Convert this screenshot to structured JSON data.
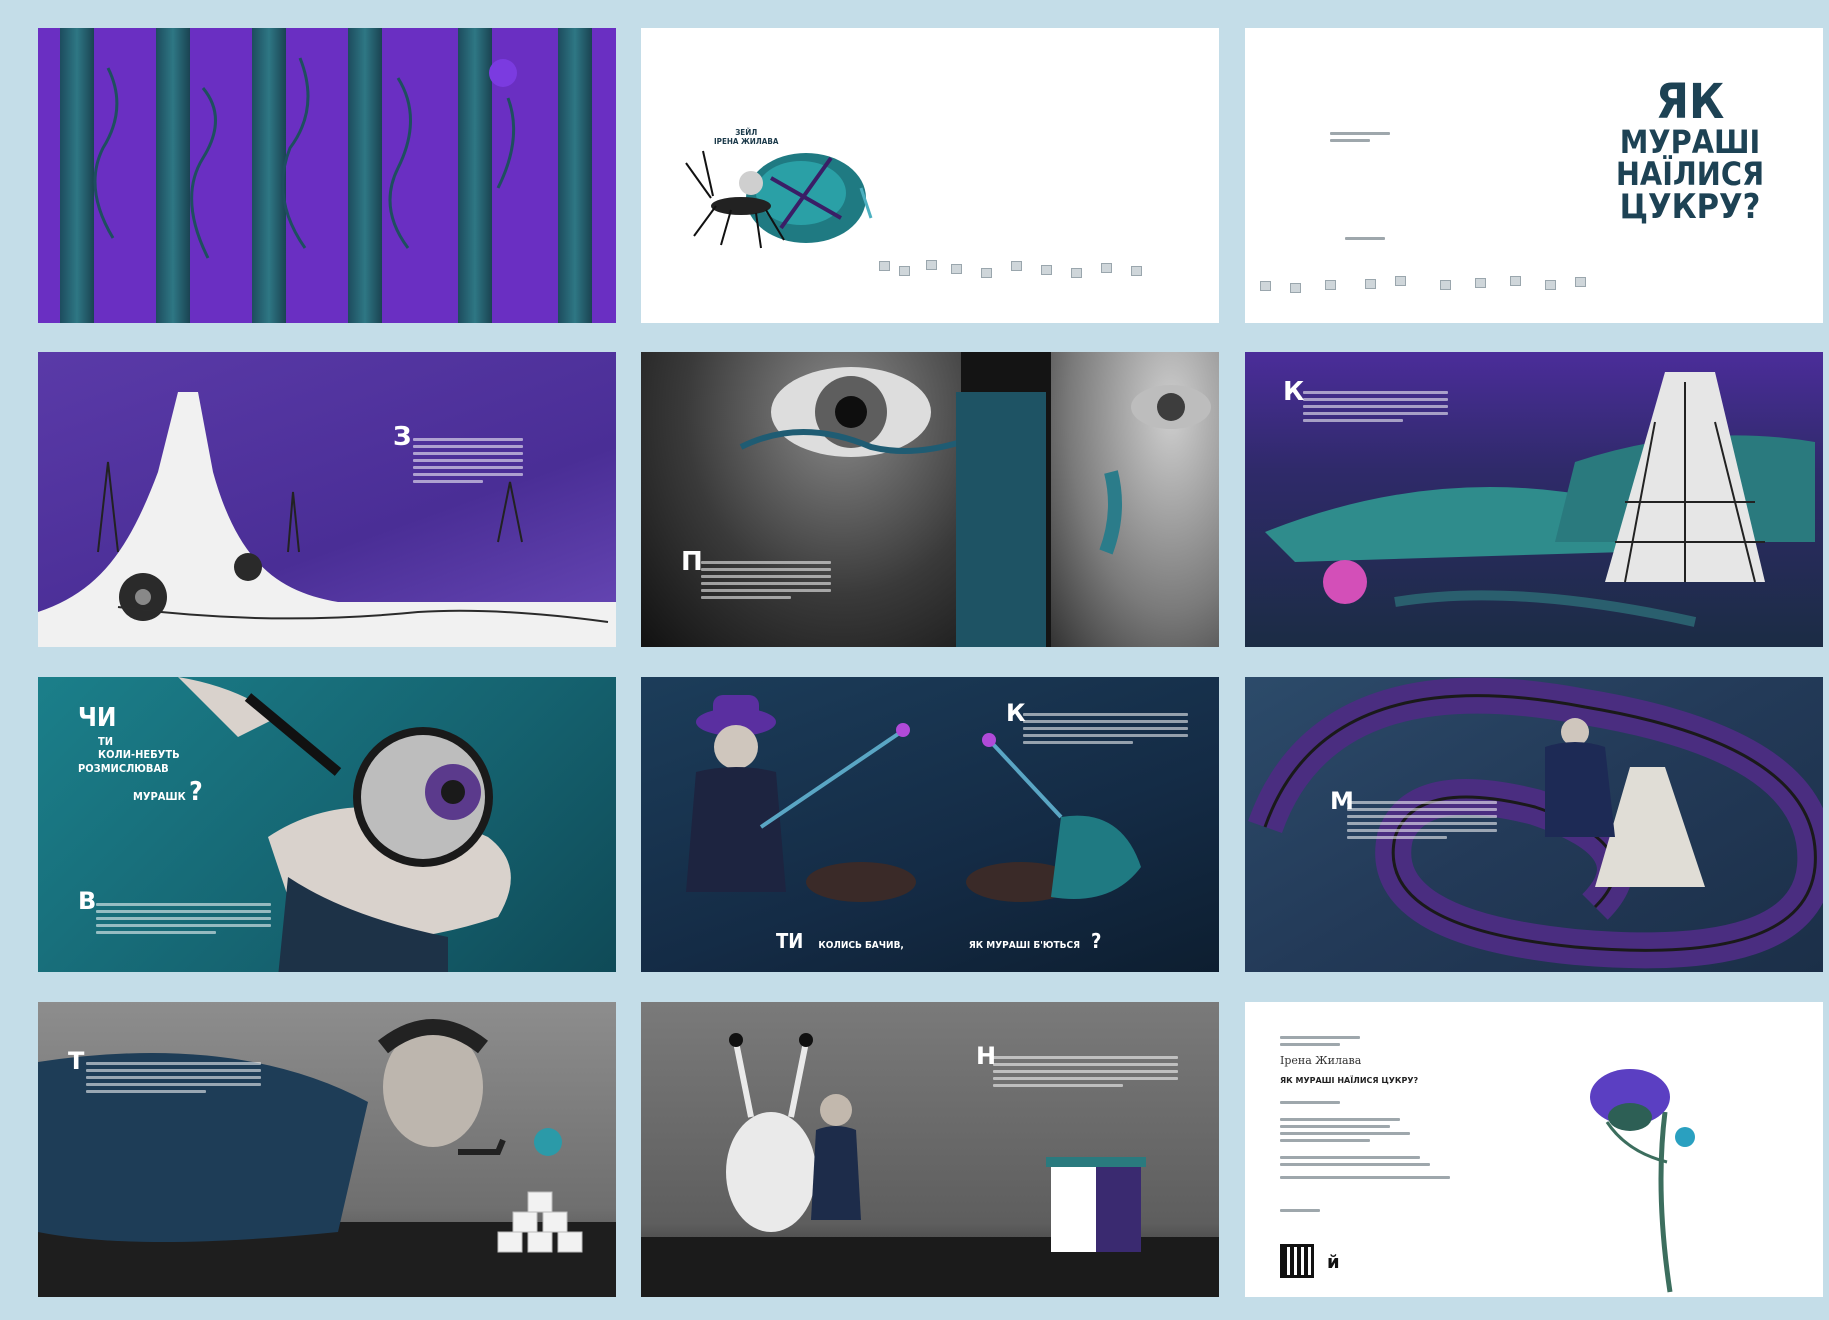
{
  "spreads": [
    {
      "id": "endpaper-pattern",
      "colors": {
        "bg": "#6b2fc4",
        "stripe": "#26606f",
        "thistle": "#7a3cd8"
      }
    },
    {
      "id": "half-title",
      "author_label": "ІРЕНА ЖИЛАВА",
      "author_prefix": "ЗЕЙЛ"
    },
    {
      "id": "title-page",
      "title_lines": [
        "ЯК",
        "МУРАШІ",
        "НАЇЛИСЯ",
        "ЦУКРУ?"
      ]
    },
    {
      "id": "salt-mountain",
      "dropcap": "З"
    },
    {
      "id": "eye-closeup",
      "dropcap": "П"
    },
    {
      "id": "shoe-mountain",
      "dropcap": "К"
    },
    {
      "id": "magnifier",
      "heading": [
        "ЧИ",
        "ТИ",
        "КОЛИ-НЕБУТЬ",
        "РОЗМИСЛЮВАВ",
        "МУРАШК",
        "?"
      ],
      "dropcap": "В"
    },
    {
      "id": "duel",
      "dropcap": "К",
      "caption_left": "ТИ",
      "caption_mid": "КОЛИСЬ БАЧИВ,",
      "caption_right": "ЯК МУРАШІ Б'ЮТЬСЯ",
      "caption_q": "?"
    },
    {
      "id": "track-loop",
      "dropcap": "М"
    },
    {
      "id": "pipe-man",
      "dropcap": "Т"
    },
    {
      "id": "door-room",
      "dropcap": "Н"
    },
    {
      "id": "imprint",
      "author": "Ірена Жилава",
      "book_title": "ЯК МУРАШІ НАЇЛИСЯ ЦУКРУ?"
    }
  ]
}
